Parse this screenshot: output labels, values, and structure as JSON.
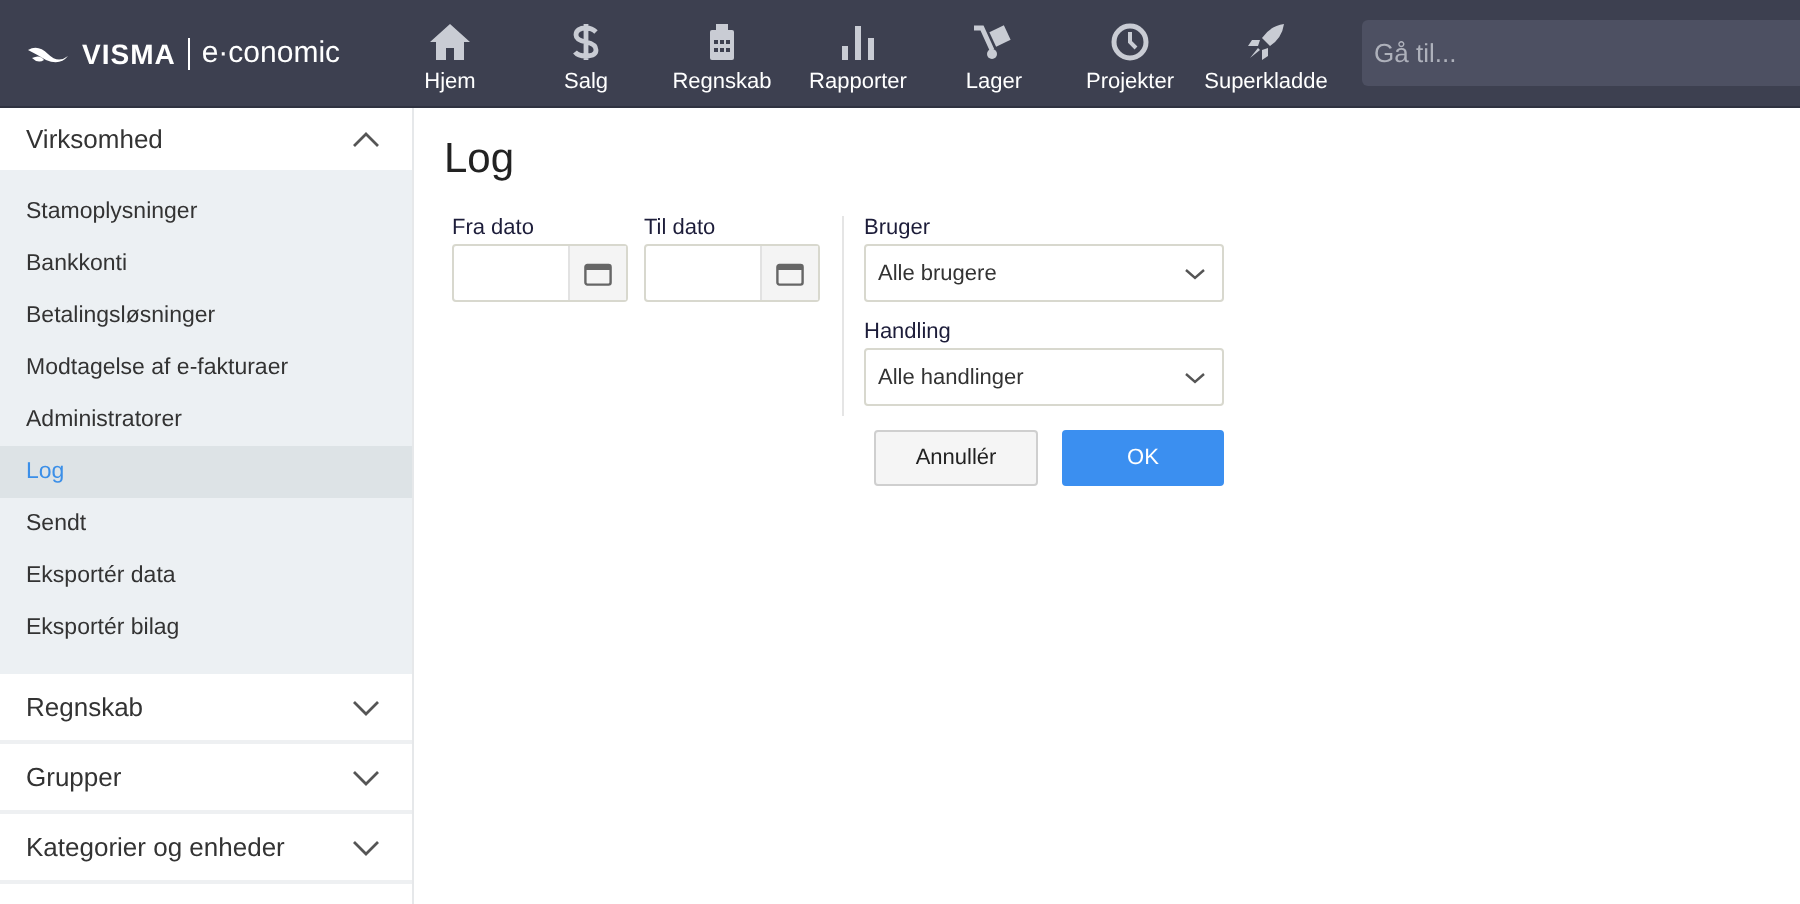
{
  "header": {
    "logo_brand": "VISMA",
    "logo_product": "e·conomic",
    "nav": [
      {
        "label": "Hjem"
      },
      {
        "label": "Salg"
      },
      {
        "label": "Regnskab"
      },
      {
        "label": "Rapporter"
      },
      {
        "label": "Lager"
      },
      {
        "label": "Projekter"
      },
      {
        "label": "Superkladde"
      }
    ],
    "search": {
      "placeholder": "Gå til..."
    }
  },
  "sidebar": {
    "sections": [
      {
        "label": "Virksomhed",
        "expanded": true,
        "items": [
          {
            "label": "Stamoplysninger",
            "selected": false
          },
          {
            "label": "Bankkonti",
            "selected": false
          },
          {
            "label": "Betalingsløsninger",
            "selected": false
          },
          {
            "label": "Modtagelse af e-fakturaer",
            "selected": false
          },
          {
            "label": "Administratorer",
            "selected": false
          },
          {
            "label": "Log",
            "selected": true
          },
          {
            "label": "Sendt",
            "selected": false
          },
          {
            "label": "Eksportér data",
            "selected": false
          },
          {
            "label": "Eksportér bilag",
            "selected": false
          }
        ]
      },
      {
        "label": "Regnskab",
        "expanded": false
      },
      {
        "label": "Grupper",
        "expanded": false
      },
      {
        "label": "Kategorier og enheder",
        "expanded": false
      }
    ]
  },
  "page": {
    "title": "Log",
    "date_fields": [
      {
        "label": "Fra dato"
      },
      {
        "label": "Til dato"
      }
    ],
    "selects": [
      {
        "label": "Bruger",
        "value": "Alle brugere"
      },
      {
        "label": "Handling",
        "value": "Alle handlinger"
      }
    ],
    "buttons": [
      {
        "label": "Annullér",
        "kind": "secondary"
      },
      {
        "label": "OK",
        "kind": "primary"
      }
    ]
  }
}
